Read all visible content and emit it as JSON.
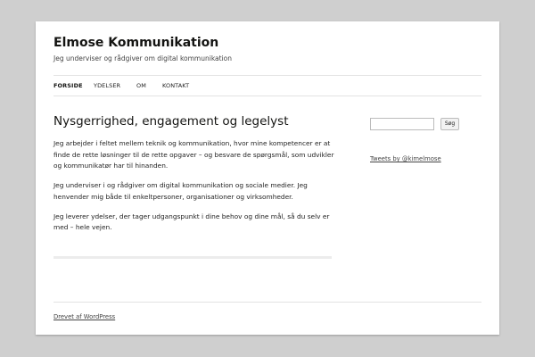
{
  "site": {
    "title": "Elmose Kommunikation",
    "description": "Jeg underviser og rådgiver om digital kommunikation"
  },
  "nav": {
    "items": [
      {
        "label": "FORSIDE",
        "current": true
      },
      {
        "label": "YDELSER",
        "current": false
      },
      {
        "label": "OM",
        "current": false
      },
      {
        "label": "KONTAKT",
        "current": false
      }
    ]
  },
  "main": {
    "title": "Nysgerrighed, engagement og legelyst",
    "paragraphs": [
      "Jeg arbejder i feltet mellem teknik og kommunikation, hvor mine kompetencer er at finde de rette løsninger til de rette opgaver – og besvare de spørgsmål, som udvikler og kommunikatør har til hinanden.",
      "Jeg underviser i og rådgiver om digital kommunikation og sociale medier. Jeg henvender mig både til enkeltpersoner, organisationer og virksomheder.",
      "Jeg leverer ydelser, der tager udgangspunkt i dine behov og dine mål, så du selv er med – hele vejen."
    ]
  },
  "sidebar": {
    "search_value": "",
    "search_button": "Søg",
    "tweets_link": "Tweets by @kimelmose"
  },
  "footer": {
    "credit": "Drevet af WordPress"
  },
  "colors": {
    "background": "#cfcfcf",
    "page": "#ffffff",
    "text": "#141412",
    "rule": "#e3e3e3"
  }
}
